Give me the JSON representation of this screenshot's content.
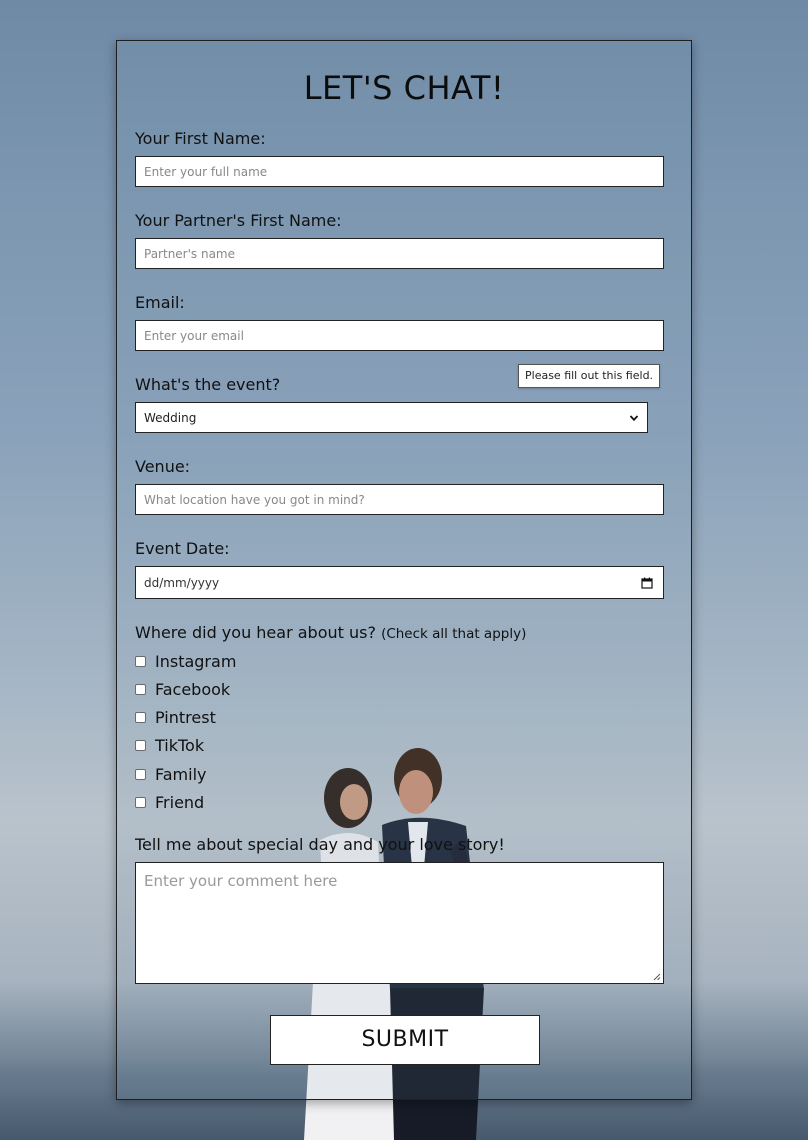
{
  "form": {
    "title": "LET'S CHAT!",
    "first_name": {
      "label": "Your First Name:",
      "placeholder": "Enter your full name",
      "value": ""
    },
    "partner_name": {
      "label": "Your Partner's First Name:",
      "placeholder": "Partner's name",
      "value": ""
    },
    "email": {
      "label": "Email:",
      "placeholder": "Enter your email",
      "value": ""
    },
    "validation_tooltip": "Please fill out this field.",
    "event": {
      "label": "What's the event?",
      "selected": "Wedding"
    },
    "venue": {
      "label": "Venue:",
      "placeholder": "What location have you got in mind?",
      "value": ""
    },
    "event_date": {
      "label": "Event Date:",
      "placeholder": "dd/mm/yyyy"
    },
    "heard_about": {
      "label": "Where did you hear about us?",
      "hint": "(Check all that apply)",
      "options": [
        "Instagram",
        "Facebook",
        "Pintrest",
        "TikTok",
        "Family",
        "Friend"
      ]
    },
    "story": {
      "label": "Tell me about special day and your love story!",
      "placeholder": "Enter your comment here"
    },
    "submit_label": "SUBMIT"
  },
  "icons": {
    "select_arrow": "chevron-down-icon",
    "date_picker": "calendar-icon",
    "resize": "resize-grip-icon"
  },
  "colors": {
    "sky_top": "#6f8aa6",
    "sky_mid": "#a3b4c4",
    "card_border": "#1f1f1f",
    "field_border": "#222222",
    "text": "#111111"
  }
}
